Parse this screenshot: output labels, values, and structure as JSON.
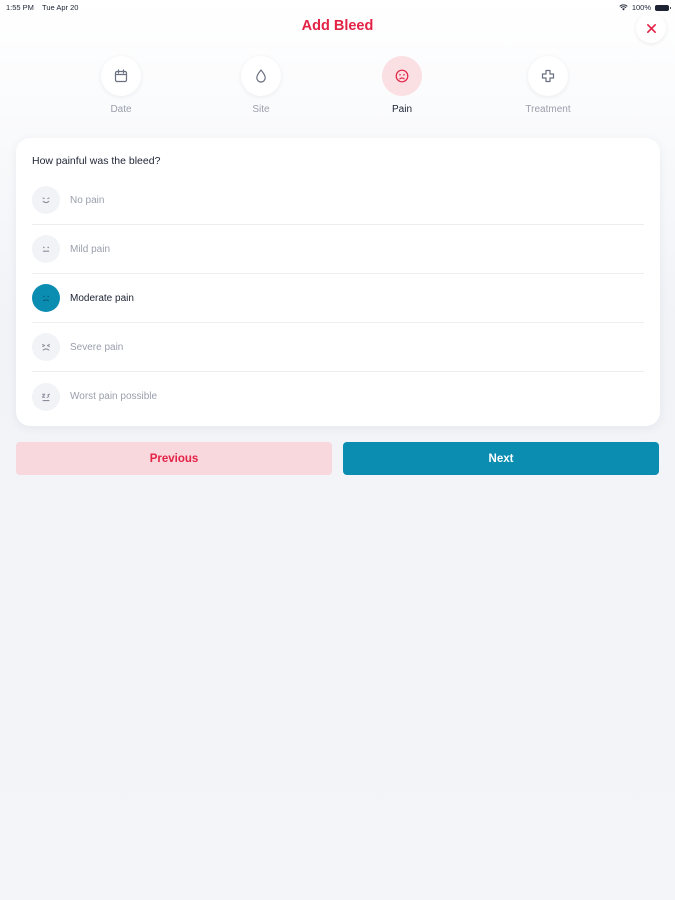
{
  "status_bar": {
    "time": "1:55 PM",
    "date": "Tue Apr 20",
    "battery": "100%"
  },
  "header": {
    "title": "Add Bleed"
  },
  "steps": [
    {
      "label": "Date",
      "icon": "calendar-icon"
    },
    {
      "label": "Site",
      "icon": "droplet-icon"
    },
    {
      "label": "Pain",
      "icon": "pain-face-icon",
      "active": true
    },
    {
      "label": "Treatment",
      "icon": "medical-cross-icon"
    }
  ],
  "question": "How painful was the bleed?",
  "options": [
    {
      "label": "No pain",
      "icon": "smile-face-icon"
    },
    {
      "label": "Mild pain",
      "icon": "neutral-face-icon"
    },
    {
      "label": "Moderate pain",
      "icon": "sad-face-icon",
      "selected": true
    },
    {
      "label": "Severe pain",
      "icon": "pained-face-icon"
    },
    {
      "label": "Worst pain possible",
      "icon": "crying-face-icon"
    }
  ],
  "buttons": {
    "previous": "Previous",
    "next": "Next"
  },
  "colors": {
    "accent_red": "#e32245",
    "accent_teal": "#0b8db2",
    "prev_bg": "#f8d7dd",
    "active_step_bg": "#fadfe3"
  }
}
